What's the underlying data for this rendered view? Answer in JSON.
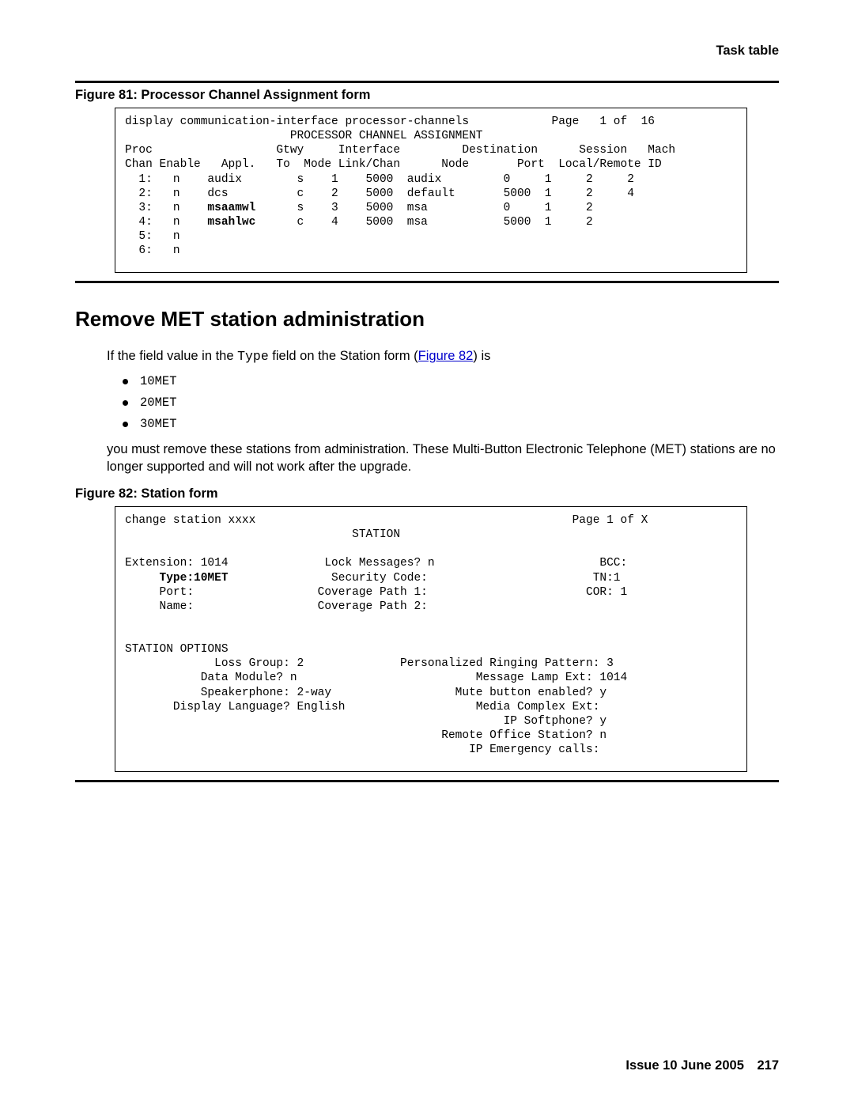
{
  "header": {
    "right": "Task table"
  },
  "figure81": {
    "caption": "Figure 81: Processor Channel Assignment form",
    "cmd": "display communication-interface processor-channels            Page   1 of  16",
    "title": "PROCESSOR CHANNEL ASSIGNMENT",
    "hdr1": "Proc                  Gtwy     Interface         Destination      Session   Mach",
    "hdr2": "Chan Enable   Appl.   To  Mode Link/Chan      Node       Port  Local/Remote ID",
    "rows": [
      "  1:   n    audix        s    1    5000  audix         0     1     2     2",
      "  2:   n    dcs          c    2    5000  default       5000  1     2     4",
      "  3:   n    ",
      "  4:   n    ",
      "  5:   n",
      "  6:   n"
    ],
    "row3_bold": "msaamwl",
    "row3_rest": "      s    3    5000  msa           0     1     2",
    "row4_bold": "msahlwc",
    "row4_rest": "      c    4    5000  msa           5000  1     2"
  },
  "section": {
    "title": "Remove MET station administration",
    "intro_a": "If the field value in the ",
    "intro_code": "Type",
    "intro_b": " field on the Station form (",
    "intro_link": "Figure 82",
    "intro_c": ") is",
    "items": [
      "10MET",
      "20MET",
      "30MET"
    ],
    "para2": "you must remove these stations from administration. These Multi-Button Electronic Telephone (MET) stations are no longer supported and will not work after the upgrade."
  },
  "figure82": {
    "caption": "Figure 82: Station form",
    "lines": [
      "change station xxxx                                              Page 1 of X",
      "                                 STATION",
      "",
      "Extension: 1014              Lock Messages? n                        BCC:",
      "     Type:10MET",
      "     Port:                  Coverage Path 1:                       COR: 1",
      "     Name:                  Coverage Path 2:",
      "",
      "",
      "STATION OPTIONS",
      "             Loss Group: 2              Personalized Ringing Pattern: 3",
      "           Data Module? n                          Message Lamp Ext: 1014",
      "           Speakerphone: 2-way                  Mute button enabled? y",
      "       Display Language? English                   Media Complex Ext:",
      "                                                       IP Softphone? y",
      "                                              Remote Office Station? n",
      "                                                  IP Emergency calls:"
    ],
    "line4_rest": "               Security Code:                        TN:1"
  },
  "footer": {
    "issue": "Issue 10   June 2005",
    "page": "217"
  }
}
